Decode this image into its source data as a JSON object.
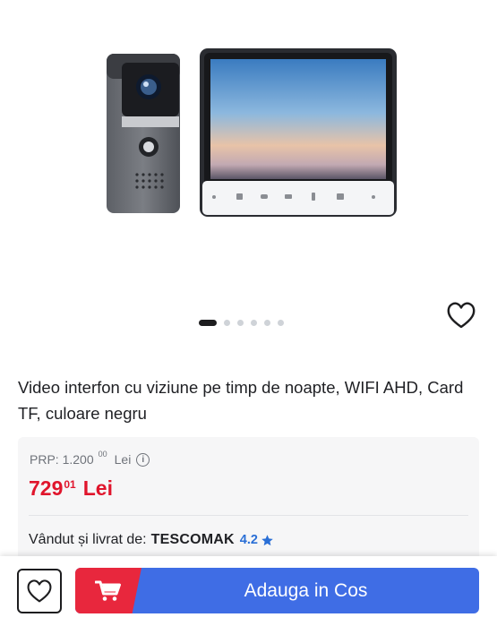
{
  "gallery": {
    "image_alt": "video-intercom-kit",
    "slide_count": 6,
    "active_slide": 1
  },
  "product": {
    "title": "Video interfon cu viziune pe timp de noapte, WIFI AHD, Card TF, culoare negru"
  },
  "pricing": {
    "prp_label": "PRP: 1.200",
    "prp_decimals": "00",
    "prp_currency": "Lei",
    "price_int": "729",
    "price_dec": "01",
    "price_currency": "Lei",
    "price_color": "#e0152c"
  },
  "seller": {
    "label": "Vândut și livrat de:",
    "name": "TESCOMAK",
    "rating": "4.2",
    "rating_color": "#2a6fd6"
  },
  "actions": {
    "add_to_cart_label": "Adauga in Cos",
    "add_color": "#3f6de5",
    "cart_color": "#e8273d"
  }
}
